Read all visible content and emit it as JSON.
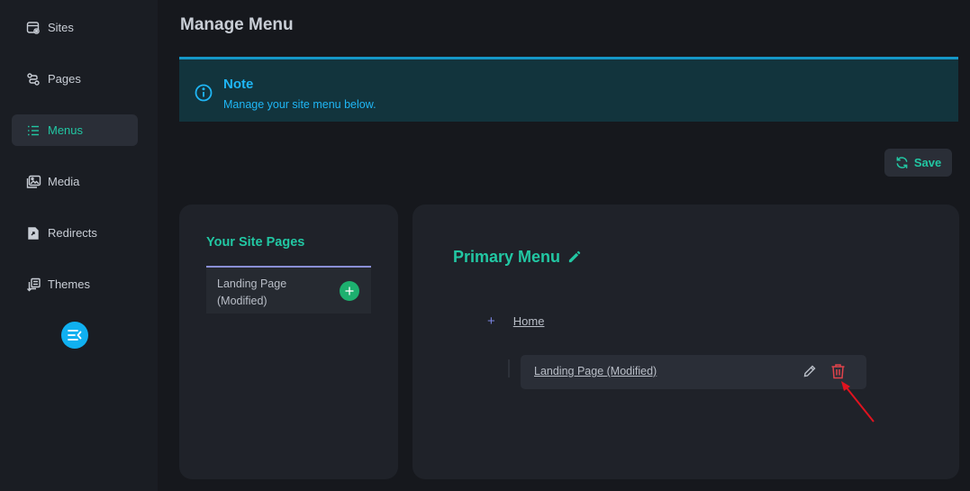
{
  "sidebar": {
    "items": [
      {
        "label": "Sites",
        "icon": "browser-gear-icon",
        "active": false
      },
      {
        "label": "Pages",
        "icon": "pages-connect-icon",
        "active": false
      },
      {
        "label": "Menus",
        "icon": "list-icon",
        "active": true
      },
      {
        "label": "Media",
        "icon": "images-icon",
        "active": false
      },
      {
        "label": "Redirects",
        "icon": "redirect-file-icon",
        "active": false
      },
      {
        "label": "Themes",
        "icon": "themes-icon",
        "active": false
      }
    ],
    "collapse_icon": "sidebar-collapse-icon"
  },
  "header": {
    "title": "Manage Menu"
  },
  "note": {
    "title": "Note",
    "text": "Manage your site menu below."
  },
  "toolbar": {
    "save_label": "Save"
  },
  "site_pages": {
    "title": "Your Site Pages",
    "pages": [
      {
        "label": "Landing Page (Modified)"
      }
    ]
  },
  "primary_menu": {
    "title": "Primary Menu",
    "items": [
      {
        "label": "Home",
        "children": [
          {
            "label": "Landing Page (Modified)"
          }
        ]
      }
    ]
  },
  "colors": {
    "accent": "#22c7a3",
    "info": "#1fb6f5",
    "danger": "#e0434b",
    "add": "#1db06f"
  }
}
